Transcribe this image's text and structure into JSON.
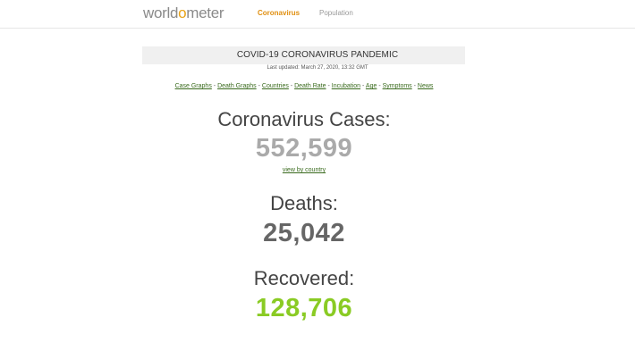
{
  "header": {
    "logo_prefix": "world",
    "logo_o": "o",
    "logo_suffix": "meter",
    "nav": [
      "Coronavirus",
      "Population"
    ],
    "accent_color": "#e08f10"
  },
  "banner": {
    "title": "COVID-19 CORONAVIRUS PANDEMIC",
    "updated": "Last updated: March 27, 2020, 13:32 GMT"
  },
  "links": [
    "Case Graphs",
    "Death Graphs",
    "Countries",
    "Death Rate",
    "Incubation",
    "Age",
    "Symptoms",
    "News"
  ],
  "stats": {
    "cases_label": "Coronavirus Cases:",
    "cases_value": "552,599",
    "view_link": "view by country",
    "deaths_label": "Deaths:",
    "deaths_value": "25,042",
    "recovered_label": "Recovered:",
    "recovered_value": "128,706",
    "colors": {
      "cases": "#aaaaaa",
      "deaths": "#666666",
      "recovered": "#8acb24"
    }
  }
}
